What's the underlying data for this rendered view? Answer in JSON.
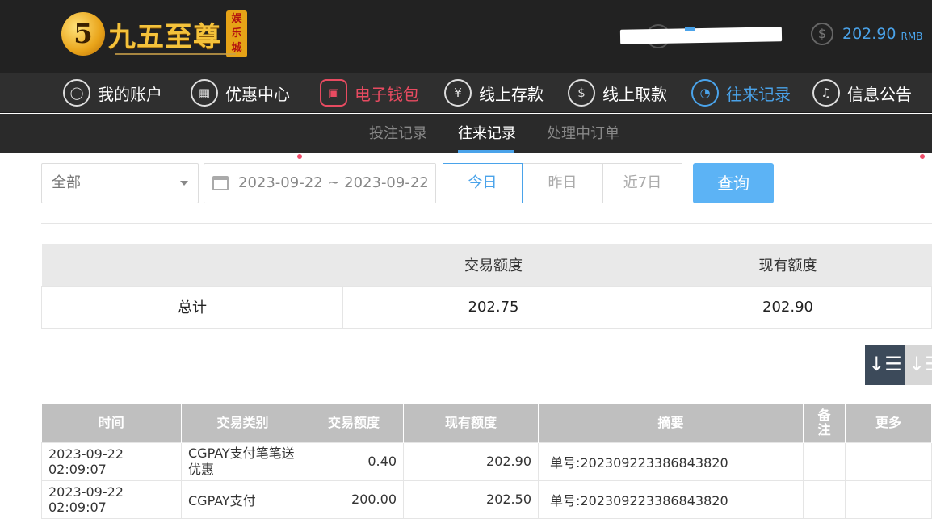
{
  "header": {
    "logo_mark": "5",
    "logo_text": "九五至尊",
    "logo_seal": "娱乐城",
    "balance_value": "202.90",
    "balance_unit": "RMB"
  },
  "nav": {
    "items": [
      {
        "label": "我的账户",
        "icon": "user-icon"
      },
      {
        "label": "优惠中心",
        "icon": "gift-icon"
      },
      {
        "label": "电子钱包",
        "icon": "wallet-icon"
      },
      {
        "label": "线上存款",
        "icon": "deposit-icon"
      },
      {
        "label": "线上取款",
        "icon": "withdraw-icon"
      },
      {
        "label": "往来记录",
        "icon": "records-icon"
      },
      {
        "label": "信息公告",
        "icon": "bell-icon"
      }
    ]
  },
  "subnav": {
    "items": [
      "投注记录",
      "往来记录",
      "处理中订单"
    ]
  },
  "filters": {
    "type_selected": "全部",
    "date_range": "2023-09-22 ~ 2023-09-22",
    "quick_ranges": [
      "今日",
      "昨日",
      "近7日"
    ],
    "query_label": "查询"
  },
  "summary": {
    "headers": [
      "",
      "交易额度",
      "现有额度"
    ],
    "row": [
      "总计",
      "202.75",
      "202.90"
    ]
  },
  "table": {
    "headers": [
      "时间",
      "交易类别",
      "交易额度",
      "现有额度",
      "摘要",
      "备注",
      "更多"
    ],
    "rows": [
      [
        "2023-09-22 02:09:07",
        "CGPAY支付笔笔送优惠",
        "0.40",
        "202.90",
        "单号:20230922338684382​0",
        "",
        ""
      ],
      [
        "2023-09-22 02:09:07",
        "CGPAY支付",
        "200.00",
        "202.50",
        "单号:202309223386843820",
        "",
        ""
      ]
    ]
  },
  "colors": {
    "accent": "#4aa3ea",
    "wallet_red": "#e84b61",
    "header_bg": "#222222"
  }
}
